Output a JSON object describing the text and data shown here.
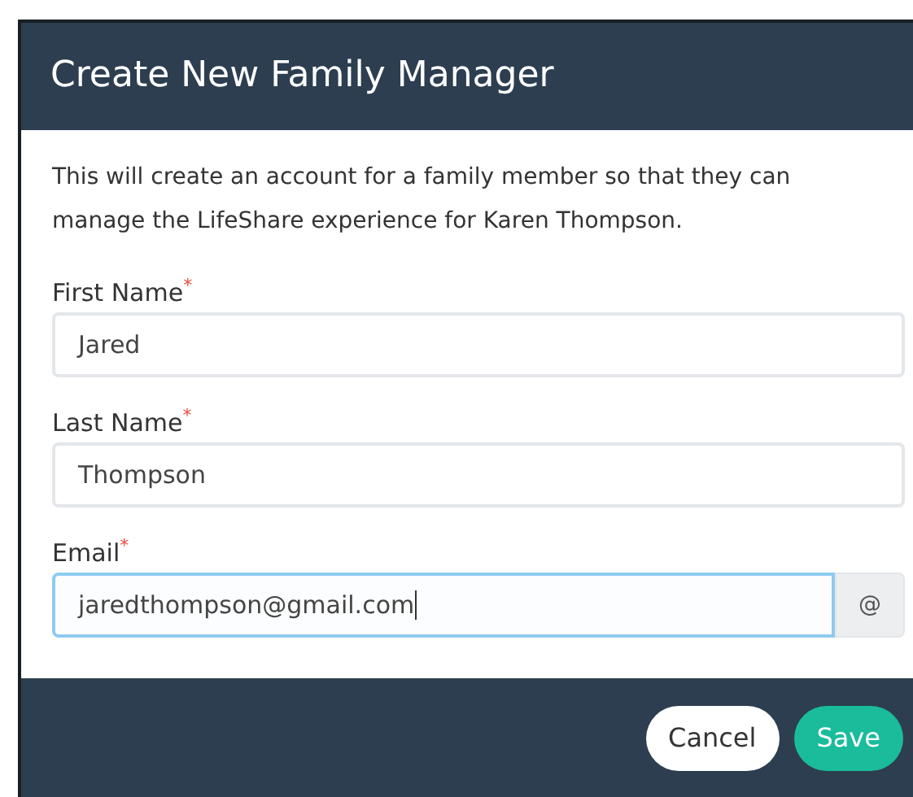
{
  "dialog": {
    "title": "Create New Family Manager",
    "description": "This will create an account for a family member so that they can manage the LifeShare experience for Karen Thompson.",
    "fields": [
      {
        "label": "First Name",
        "required_mark": "*",
        "value": "Jared",
        "focused": false
      },
      {
        "label": "Last Name",
        "required_mark": "*",
        "value": "Thompson",
        "focused": false
      },
      {
        "label": "Email",
        "required_mark": "*",
        "value": "jaredthompson@gmail.com",
        "focused": true,
        "addon": "@"
      }
    ],
    "buttons": [
      {
        "label": "Cancel",
        "kind": "secondary"
      },
      {
        "label": "Save",
        "kind": "primary"
      }
    ]
  }
}
